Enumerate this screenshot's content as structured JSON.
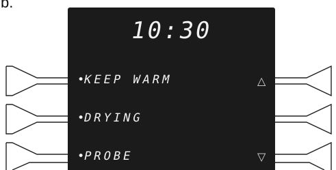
{
  "figure_label": "b.",
  "display": {
    "time": "10:30",
    "menu": [
      {
        "bullet": "•",
        "label": "KEEP WARM"
      },
      {
        "bullet": "•",
        "label": "DRYING"
      },
      {
        "bullet": "•",
        "label": "PROBE"
      }
    ],
    "scroll_up": "△",
    "scroll_down": "▽"
  }
}
